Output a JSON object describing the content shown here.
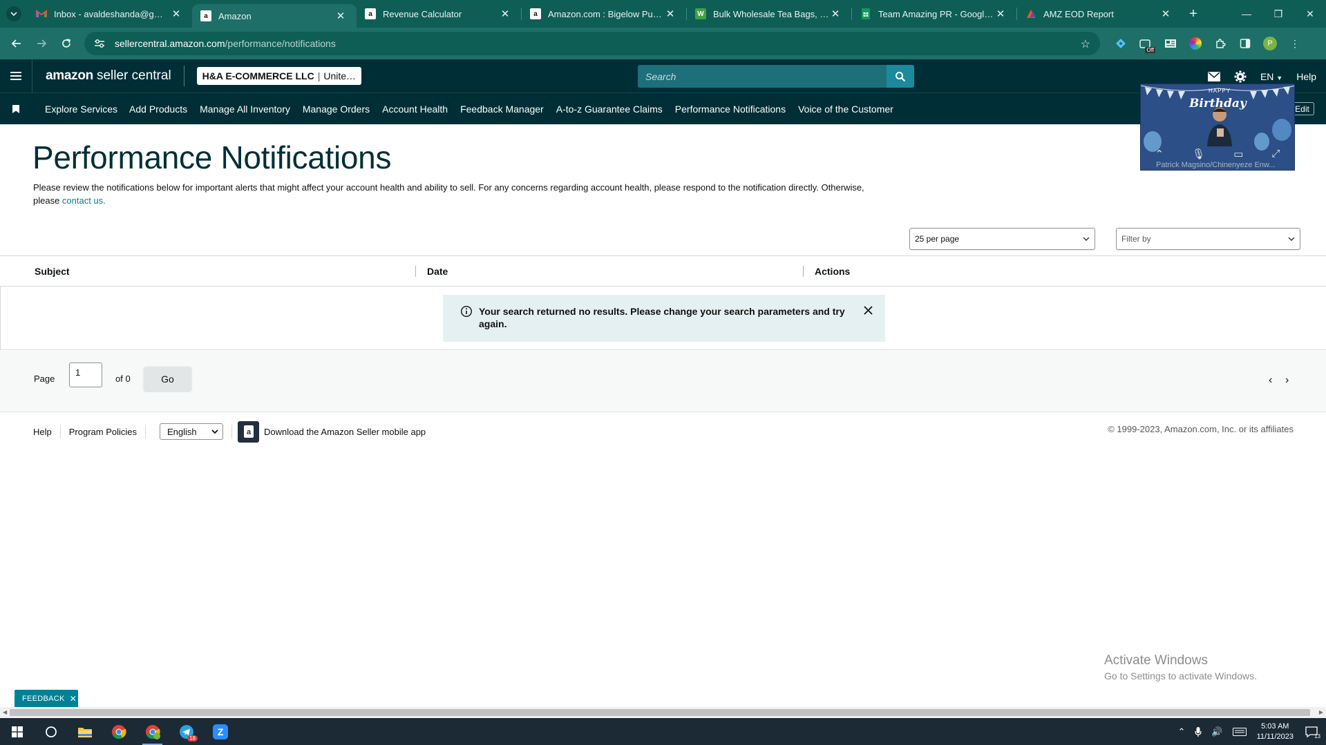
{
  "browser": {
    "tabs": [
      {
        "title": "Inbox - avaldeshanda@gmail.co",
        "favicon": "gmail-icon",
        "color": "#ea4335"
      },
      {
        "title": "Amazon",
        "favicon": "amazon-icon",
        "color": "#111111"
      },
      {
        "title": "Revenue Calculator",
        "favicon": "amazon-icon",
        "color": "#111111"
      },
      {
        "title": "Amazon.com : Bigelow Pumpkin",
        "favicon": "amazon-icon",
        "color": "#111111"
      },
      {
        "title": "Bulk Wholesale Tea Bags, Sache",
        "favicon": "leaf-icon",
        "color": "#43a047"
      },
      {
        "title": "Team Amazing PR - Google She",
        "favicon": "sheets-icon",
        "color": "#0f9d58"
      },
      {
        "title": "AMZ EOD Report",
        "favicon": "report-icon",
        "color": "#f4511e"
      }
    ],
    "url_host": "sellercentral.amazon.com",
    "url_path": "/performance/notifications",
    "profile_initial": "P",
    "ext_badge": "Off"
  },
  "header": {
    "logo_amazon": "amazon",
    "logo_product": "seller central",
    "account_name": "H&A E-COMMERCE LLC",
    "account_region": "Unite…",
    "search_placeholder": "Search",
    "language": "EN",
    "help": "Help"
  },
  "nav": {
    "items": [
      "Explore Services",
      "Add Products",
      "Manage All Inventory",
      "Manage Orders",
      "Account Health",
      "Feedback Manager",
      "A-to-z Guarantee Claims",
      "Performance Notifications",
      "Voice of the Customer"
    ],
    "edit": "Edit"
  },
  "video_call": {
    "banner_top": "HAPPY",
    "banner_main": "Birthday",
    "participants": "Patrick Magsino/Chinenyeze Enw..."
  },
  "main": {
    "title": "Performance Notifications",
    "intro_text": "Please review the notifications below for important alerts that might affect your account health and ability to sell. For any concerns regarding account health, please respond to the notification directly. Otherwise, please ",
    "contact_link": "contact us.",
    "per_page": "25 per page",
    "filter_placeholder": "Filter by",
    "columns": [
      "Subject",
      "Date",
      "Actions"
    ],
    "empty_message": "Your search returned no results. Please change your search parameters and try again."
  },
  "pager": {
    "page_label": "Page",
    "page_value": "1",
    "of_label": "of 0",
    "go_label": "Go"
  },
  "footer": {
    "help": "Help",
    "policies": "Program Policies",
    "language": "English",
    "app_link": "Download the Amazon Seller mobile app",
    "copyright": "© 1999-2023, Amazon.com, Inc. or its affiliates"
  },
  "watermark": {
    "line1": "Activate Windows",
    "line2": "Go to Settings to activate Windows."
  },
  "feedback": {
    "label": "FEEDBACK"
  },
  "taskbar": {
    "time": "5:03 AM",
    "date": "11/11/2023",
    "telegram_badge": "18",
    "notif_count": "13"
  },
  "colors": {
    "header_bg": "#002e36",
    "accent": "#008296",
    "alert_bg": "#e5f0f2",
    "browser_frame": "#0f5e56"
  }
}
